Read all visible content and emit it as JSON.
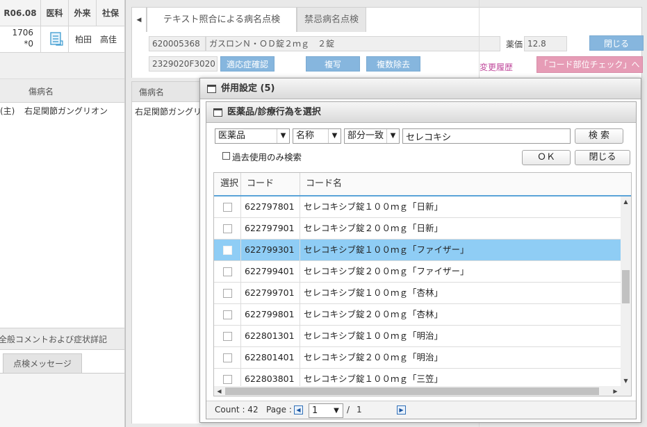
{
  "patient_header": {
    "cells": [
      "R06.08",
      "医科",
      "外来",
      "社保"
    ],
    "id_line1": "1706",
    "id_line2": "*0",
    "doctor": "柏田",
    "doctor2": "高佳"
  },
  "left_disease": {
    "header": "傷病名",
    "row_prefix": "(主)",
    "row_name": "右足関節ガングリオン"
  },
  "left_bottom": {
    "comment": "全般コメントおよび症状詳記",
    "message_tab": "点検メッセージ"
  },
  "main": {
    "tab_left_arrow": "◀",
    "tabs": [
      {
        "label": "テキスト照合による病名点検"
      },
      {
        "label": "禁忌病名点検"
      }
    ],
    "drug_code": "620005368",
    "drug_name": "ガスロンＮ・ＯＤ錠２ｍｇ　２錠",
    "price_label": "薬価",
    "price_value": "12.8",
    "close_label": "閉じる",
    "yj_code": "2329020F3020",
    "indication_btn": "適応症確認",
    "copy_btn": "複写",
    "multi_delete_btn": "複数除去",
    "history_link": "変更履歴",
    "code_check_btn": "「コード部位チェック」へ",
    "disease_header": "傷病名",
    "disease_row": "右足関節ガングリ"
  },
  "dialog_combo": {
    "title": "併用設定 (5)"
  },
  "dialog_select": {
    "title": "医薬品/診療行為を選択",
    "type_select": "医薬品",
    "field_select": "名称",
    "match_select": "部分一致",
    "search_value": "セレコキシ",
    "search_btn": "検 索",
    "past_only_label": "過去使用のみ検索",
    "ok_btn": "ＯＫ",
    "close_btn": "閉じる"
  },
  "table": {
    "headers": {
      "select": "選択",
      "code": "コード",
      "name": "コード名"
    },
    "selected_index": 2,
    "rows": [
      {
        "code": "622797801",
        "name": "セレコキシブ錠１００ｍｇ「日新」"
      },
      {
        "code": "622797901",
        "name": "セレコキシブ錠２００ｍｇ「日新」"
      },
      {
        "code": "622799301",
        "name": "セレコキシブ錠１００ｍｇ「ファイザー」"
      },
      {
        "code": "622799401",
        "name": "セレコキシブ錠２００ｍｇ「ファイザー」"
      },
      {
        "code": "622799701",
        "name": "セレコキシブ錠１００ｍｇ「杏林」"
      },
      {
        "code": "622799801",
        "name": "セレコキシブ錠２００ｍｇ「杏林」"
      },
      {
        "code": "622801301",
        "name": "セレコキシブ錠１００ｍｇ「明治」"
      },
      {
        "code": "622801401",
        "name": "セレコキシブ錠２００ｍｇ「明治」"
      },
      {
        "code": "622803801",
        "name": "セレコキシブ錠１００ｍｇ「三笠」"
      }
    ]
  },
  "pager": {
    "count_label": "Count : 42",
    "page_label": "Page :",
    "page_value": "1",
    "separator": "/",
    "total_pages": "1"
  },
  "colors": {
    "selected_row": "#8fcdf5",
    "header_rule": "#5aa3d8",
    "blue_button": "#86b6de",
    "pink_button": "#e69cb6",
    "history_link": "#c04a9c"
  },
  "icons": {
    "note": "note-icon",
    "window": "window-icon",
    "dropdown": "chevron-down-icon",
    "page_prev": "page-prev-icon",
    "page_next": "page-next-icon"
  }
}
